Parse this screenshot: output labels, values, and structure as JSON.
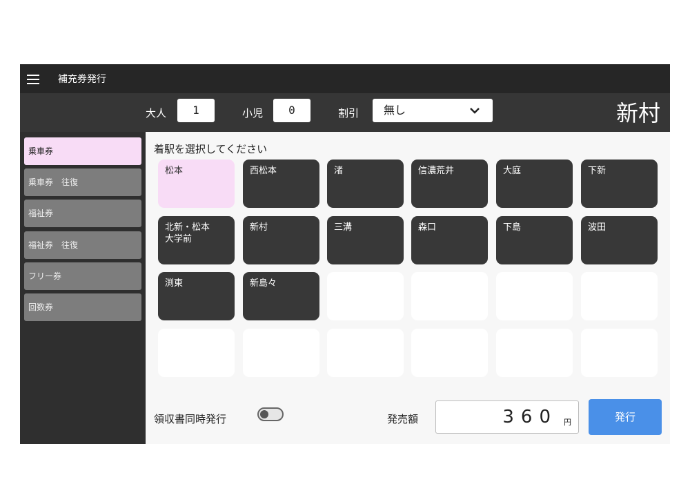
{
  "titlebar": {
    "title": "補充券発行"
  },
  "controls": {
    "adult_label": "大人",
    "adult_value": "1",
    "child_label": "小児",
    "child_value": "0",
    "discount_label": "割引",
    "discount_value": "無し",
    "current_station": "新村"
  },
  "sidebar": {
    "items": [
      {
        "label": "乗車券"
      },
      {
        "label": "乗車券　往復"
      },
      {
        "label": "福祉券"
      },
      {
        "label": "福祉券　往復"
      },
      {
        "label": "フリー券"
      },
      {
        "label": "回数券"
      }
    ]
  },
  "main": {
    "prompt": "着駅を選択してください",
    "stations": [
      {
        "label": "松本"
      },
      {
        "label": "西松本"
      },
      {
        "label": "渚"
      },
      {
        "label": "信濃荒井"
      },
      {
        "label": "大庭"
      },
      {
        "label": "下新"
      },
      {
        "label": "北新・松本\n大学前"
      },
      {
        "label": "新村"
      },
      {
        "label": "三溝"
      },
      {
        "label": "森口"
      },
      {
        "label": "下島"
      },
      {
        "label": "波田"
      },
      {
        "label": "渕東"
      },
      {
        "label": "新島々"
      }
    ]
  },
  "footer": {
    "receipt_label": "領収書同時発行",
    "amount_label": "発売額",
    "amount_value": "360",
    "amount_unit": "円",
    "issue_label": "発行"
  },
  "colors": {
    "selected": "#f8dcf6",
    "tile": "#383838",
    "issue_button": "#4a90e8"
  }
}
